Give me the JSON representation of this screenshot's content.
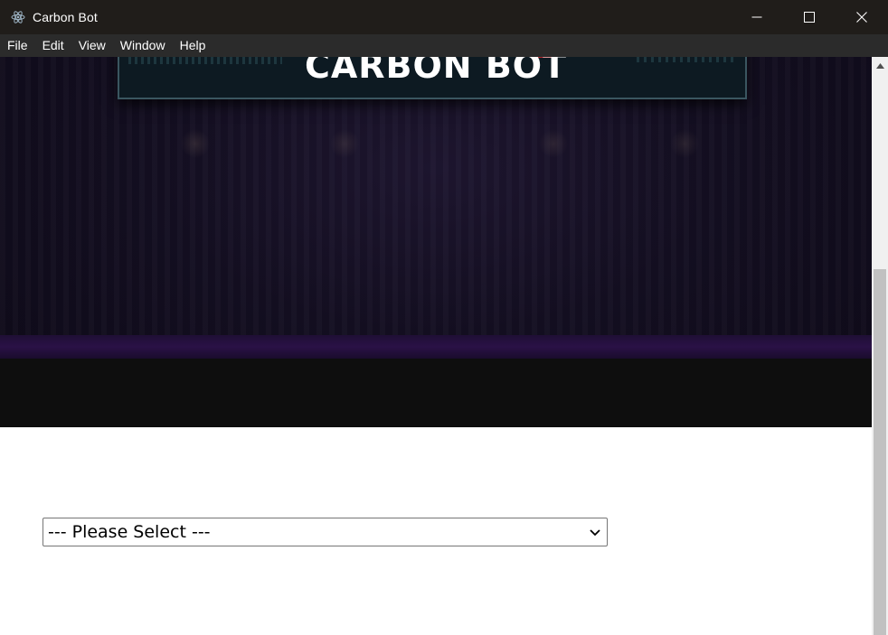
{
  "window": {
    "title": "Carbon Bot",
    "app_icon": "electron-icon"
  },
  "window_controls": {
    "minimize": "minimize-icon",
    "maximize": "maximize-icon",
    "close": "close-icon"
  },
  "menu": {
    "items": [
      {
        "label": "File"
      },
      {
        "label": "Edit"
      },
      {
        "label": "View"
      },
      {
        "label": "Window"
      },
      {
        "label": "Help"
      }
    ]
  },
  "hero": {
    "title": "CARBON BOT"
  },
  "form": {
    "select": {
      "selected": "--- Please Select ---"
    }
  },
  "colors": {
    "titlebar": "#201d1a",
    "menubar": "#2b2b2b",
    "hero_dark": "#140f22",
    "hero_band_purple": "#2a1146",
    "scroll_thumb": "#c1c1c1"
  }
}
